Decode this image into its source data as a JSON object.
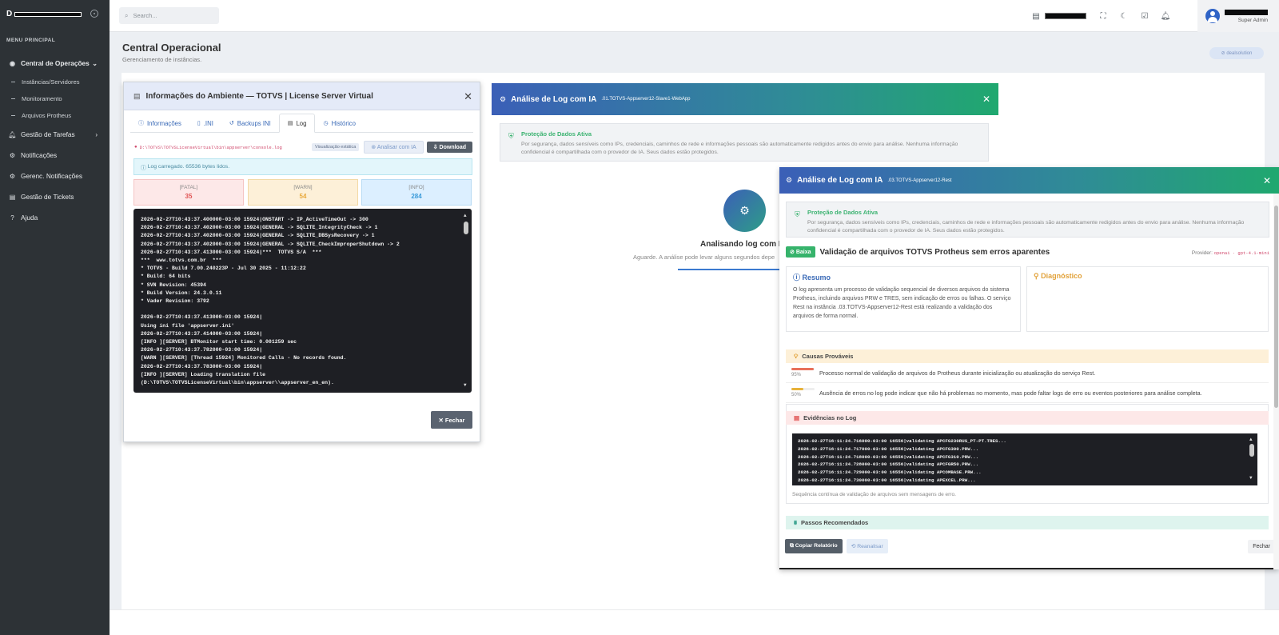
{
  "brand": {
    "letter": "D"
  },
  "sidebar": {
    "menu_title": "MENU PRINCIPAL",
    "items": [
      {
        "label": "Central de Operações",
        "icon": "globe-icon"
      },
      {
        "label": "Instâncias/Servidores"
      },
      {
        "label": "Monitoramento"
      },
      {
        "label": "Arquivos Protheus"
      },
      {
        "label": "Gestão de Tarefas",
        "icon": "bell-icon"
      },
      {
        "label": "Notificações",
        "icon": "gear-icon"
      },
      {
        "label": "Gerenc. Notificações",
        "icon": "gear-icon"
      },
      {
        "label": "Gestão de Tickets",
        "icon": "ticket-icon"
      },
      {
        "label": "Ajuda",
        "icon": "help-icon"
      }
    ]
  },
  "topbar": {
    "search_placeholder": "Search...",
    "user_role": "Super Admin"
  },
  "page": {
    "title": "Central Operacional",
    "subtitle": "Gerenciamento de instâncias.",
    "pill": "dealsolution"
  },
  "modal_env": {
    "title": "Informações do Ambiente — TOTVS | License Server Virtual",
    "tabs": [
      "Informações",
      ".INI",
      "Backups INI",
      "Log",
      "Histórico"
    ],
    "path": "D:\\TOTVS\\TOTVSLicenseVirtual\\bin\\appserver\\console.log",
    "static_badge": "Visualização estática",
    "analyze_btn": "Analisar com IA",
    "download_btn": "Download",
    "loaded_msg": "Log carregado. 65536 bytes lidos.",
    "counters": {
      "fatal_label": "[FATAL]",
      "fatal": "35",
      "warn_label": "[WARN]",
      "warn": "54",
      "info_label": "[INFO]",
      "info": "284"
    },
    "console": "2026-02-27T10:43:37.400000-03:00 15924|ONSTART -> IP_ActiveTimeOut -> 300\n2026-02-27T10:43:37.402000-03:00 15924|GENERAL -> SQLITE_IntegrityCheck -> 1\n2026-02-27T10:43:37.402000-03:00 15924|GENERAL -> SQLITE_DBSysRecovery -> 1\n2026-02-27T10:43:37.402000-03:00 15924|GENERAL -> SQLITE_CheckImproperShutdown -> 2\n2026-02-27T10:43:37.413000-03:00 15924|***  TOTVS S/A  ***\n***  www.totvs.com.br  ***\n* TOTVS - Build 7.00.240223P - Jul 30 2025 - 11:12:22\n* Build: 64 bits\n* SVN Revision: 45394\n* Build Version: 24.3.0.11\n* Vader Revision: 3792\n\n2026-02-27T10:43:37.413000-03:00 15924|\nUsing ini file 'appserver.ini'\n2026-02-27T10:43:37.414000-03:00 15924|\n[INFO ][SERVER] BTMonitor start time: 0.001259 sec\n2026-02-27T10:43:37.782000-03:00 15924|\n[WARN ][SERVER] [Thread 15924] Monitored Calls - No records found.\n2026-02-27T10:43:37.783000-03:00 15924|\n[INFO ][SERVER] Loading translation file\n(D:\\TOTVS\\TOTVSLicenseVirtual\\bin\\appserver\\\\appserver_en_en).",
    "close_btn": "Fechar"
  },
  "modal_ia1": {
    "title": "Análise de Log com IA",
    "instance": ".01.TOTVS-Appserver12-Slave1-WebApp",
    "protection_title": "Proteção de Dados Ativa",
    "protection_text": "Por segurança, dados sensíveis como IPs, credenciais, caminhos de rede e informações pessoais são automaticamente redigidos antes do envio para análise. Nenhuma informação confidencial é compartilhada com o provedor de IA. Seus dados estão protegidos.",
    "analyzing": "Analisando log com IA",
    "wait": "Aguarde. A análise pode levar alguns segundos depe"
  },
  "modal_ia2": {
    "title": "Análise de Log com IA",
    "instance": ".03.TOTVS-Appserver12-Rest",
    "protection_title": "Proteção de Dados Ativa",
    "protection_text": "Por segurança, dados sensíveis como IPs, credenciais, caminhos de rede e informações pessoais são automaticamente redigidos antes do envio para análise. Nenhuma informação confidencial é compartilhada com o provedor de IA. Seus dados estão protegidos.",
    "severity": "Baixa",
    "verdict": "Validação de arquivos TOTVS Protheus sem erros aparentes",
    "provider_label": "Provider:",
    "provider": "openai · gpt-4.1-mini",
    "summary_title": "Resumo",
    "summary_text": "O log apresenta um processo de validação sequencial de diversos arquivos do sistema Protheus, incluindo arquivos PRW e TRES, sem indicação de erros ou falhas. O serviço Rest na instância .03.TOTVS-Appserver12-Rest está realizando a validação dos arquivos de forma normal.",
    "diag_title": "Diagnóstico",
    "causes_title": "Causas Prováveis",
    "causes": [
      {
        "pct": "95%",
        "value": 0.95,
        "color": "#e8705a",
        "text": "Processo normal de validação de arquivos do Protheus durante inicialização ou atualização do serviço Rest."
      },
      {
        "pct": "50%",
        "value": 0.5,
        "color": "#e8b23a",
        "text": "Ausência de erros no log pode indicar que não há problemas no momento, mas pode faltar logs de erro ou eventos posteriores para análise completa."
      }
    ],
    "evid_title": "Evidências no Log",
    "evid_console": "2026-02-27T16:11:24.716000-03:00 16556|validating APCFG230RUS_PT-PT.TRES...\n2026-02-27T16:11:24.717000-03:00 16556|validating APCFG300.PRW...\n2026-02-27T16:11:24.718000-03:00 16556|validating APCFG310.PRW...\n2026-02-27T16:11:24.728000-03:00 16556|validating APCFGR50.PRW...\n2026-02-27T16:11:24.729000-03:00 16556|validating APCOMBASE.PRW...\n2026-02-27T16:11:24.730000-03:00 16556|validating APEXCEL.PRW...",
    "evid_note": "Sequência contínua de validação de arquivos sem mensagens de erro.",
    "steps_title": "Passos Recomendados",
    "copy_btn": "Copiar Relatório",
    "reanalyze_btn": "Reanalisar",
    "close_btn": "Fechar"
  }
}
